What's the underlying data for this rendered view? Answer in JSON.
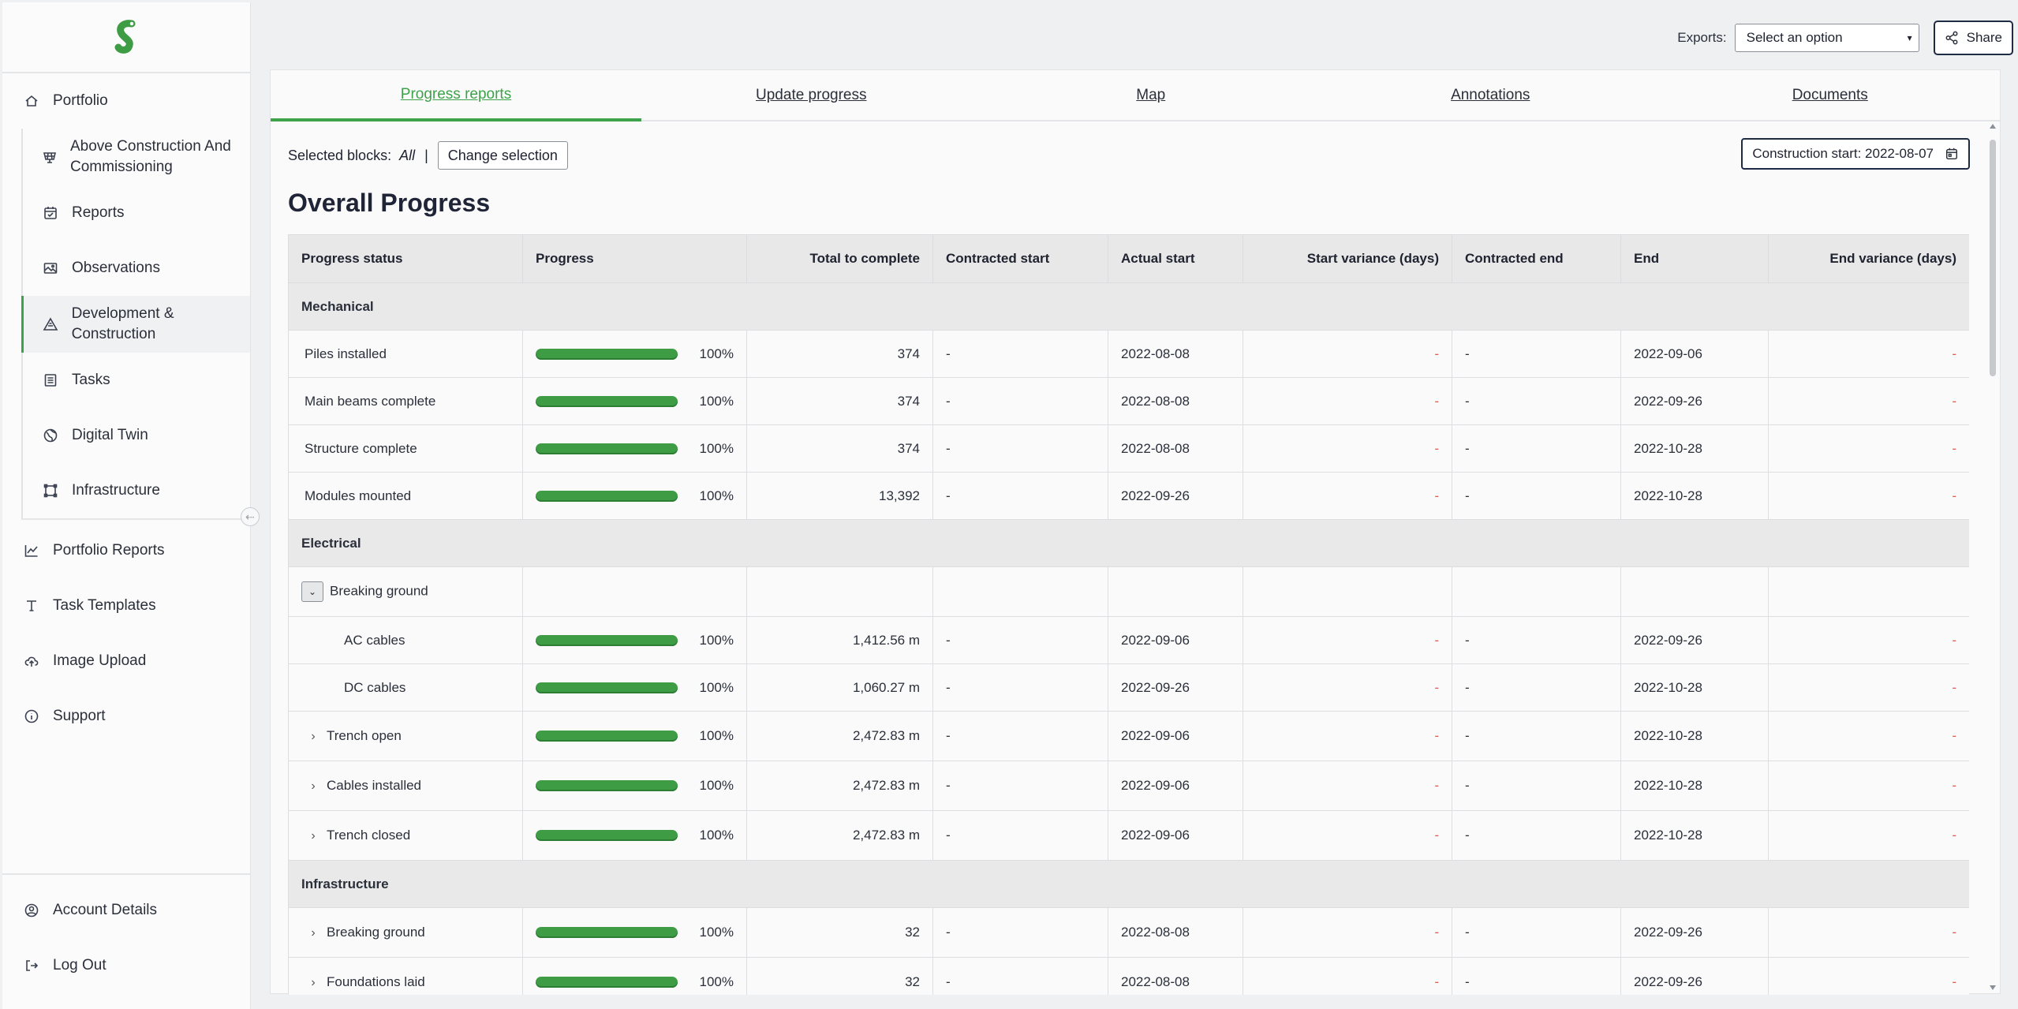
{
  "sidebar": {
    "top_items": [
      {
        "label": "Portfolio",
        "icon": "home-icon"
      }
    ],
    "sub_items": [
      {
        "label": "Above Construction And Commissioning",
        "icon": "solar-panel-icon"
      },
      {
        "label": "Reports",
        "icon": "calendar-check-icon"
      },
      {
        "label": "Observations",
        "icon": "image-icon"
      },
      {
        "label": "Development & Construction",
        "icon": "warning-cone-icon",
        "active": true
      },
      {
        "label": "Tasks",
        "icon": "list-icon"
      },
      {
        "label": "Digital Twin",
        "icon": "globe-icon"
      },
      {
        "label": "Infrastructure",
        "icon": "frame-icon"
      }
    ],
    "lower_items": [
      {
        "label": "Portfolio Reports",
        "icon": "chart-line-icon"
      },
      {
        "label": "Task Templates",
        "icon": "text-t-icon"
      },
      {
        "label": "Image Upload",
        "icon": "cloud-upload-icon"
      },
      {
        "label": "Support",
        "icon": "info-icon"
      }
    ],
    "bottom_items": [
      {
        "label": "Account Details",
        "icon": "user-circle-icon"
      },
      {
        "label": "Log Out",
        "icon": "logout-icon"
      }
    ]
  },
  "topbar": {
    "exports_label": "Exports:",
    "exports_value": "Select an option",
    "share_label": "Share"
  },
  "tabs": [
    "Progress reports",
    "Update progress",
    "Map",
    "Annotations",
    "Documents"
  ],
  "toolbar": {
    "selected_blocks_label": "Selected blocks:",
    "selected_blocks_value": "All",
    "separator": "|",
    "change_selection": "Change selection",
    "construction_start": "Construction start: 2022-08-07"
  },
  "page_title": "Overall Progress",
  "table": {
    "headers": [
      "Progress status",
      "Progress",
      "Total to complete",
      "Contracted start",
      "Actual start",
      "Start variance (days)",
      "Contracted end",
      "End",
      "End variance (days)"
    ],
    "rows": [
      {
        "type": "group",
        "label": "Mechanical"
      },
      {
        "type": "row",
        "label": "Piles installed",
        "progress": "100%",
        "total": "374",
        "cstart": "-",
        "astart": "2022-08-08",
        "svar": "-",
        "cend": "-",
        "end": "2022-09-06",
        "evar": "-"
      },
      {
        "type": "row",
        "label": "Main beams complete",
        "progress": "100%",
        "total": "374",
        "cstart": "-",
        "astart": "2022-08-08",
        "svar": "-",
        "cend": "-",
        "end": "2022-09-26",
        "evar": "-"
      },
      {
        "type": "row",
        "label": "Structure complete",
        "progress": "100%",
        "total": "374",
        "cstart": "-",
        "astart": "2022-08-08",
        "svar": "-",
        "cend": "-",
        "end": "2022-10-28",
        "evar": "-"
      },
      {
        "type": "row",
        "label": "Modules mounted",
        "progress": "100%",
        "total": "13,392",
        "cstart": "-",
        "astart": "2022-09-26",
        "svar": "-",
        "cend": "-",
        "end": "2022-10-28",
        "evar": "-"
      },
      {
        "type": "group",
        "label": "Electrical"
      },
      {
        "type": "parent-open",
        "label": "Breaking ground"
      },
      {
        "type": "child",
        "label": "AC cables",
        "progress": "100%",
        "total": "1,412.56 m",
        "cstart": "-",
        "astart": "2022-09-06",
        "svar": "-",
        "cend": "-",
        "end": "2022-09-26",
        "evar": "-"
      },
      {
        "type": "child",
        "label": "DC cables",
        "progress": "100%",
        "total": "1,060.27 m",
        "cstart": "-",
        "astart": "2022-09-26",
        "svar": "-",
        "cend": "-",
        "end": "2022-10-28",
        "evar": "-"
      },
      {
        "type": "collapsed",
        "label": "Trench open",
        "progress": "100%",
        "total": "2,472.83 m",
        "cstart": "-",
        "astart": "2022-09-06",
        "svar": "-",
        "cend": "-",
        "end": "2022-10-28",
        "evar": "-"
      },
      {
        "type": "collapsed",
        "label": "Cables installed",
        "progress": "100%",
        "total": "2,472.83 m",
        "cstart": "-",
        "astart": "2022-09-06",
        "svar": "-",
        "cend": "-",
        "end": "2022-10-28",
        "evar": "-"
      },
      {
        "type": "collapsed",
        "label": "Trench closed",
        "progress": "100%",
        "total": "2,472.83 m",
        "cstart": "-",
        "astart": "2022-09-06",
        "svar": "-",
        "cend": "-",
        "end": "2022-10-28",
        "evar": "-"
      },
      {
        "type": "group",
        "label": "Infrastructure"
      },
      {
        "type": "collapsed",
        "label": "Breaking ground",
        "progress": "100%",
        "total": "32",
        "cstart": "-",
        "astart": "2022-08-08",
        "svar": "-",
        "cend": "-",
        "end": "2022-09-26",
        "evar": "-"
      },
      {
        "type": "collapsed",
        "label": "Foundations laid",
        "progress": "100%",
        "total": "32",
        "cstart": "-",
        "astart": "2022-08-08",
        "svar": "-",
        "cend": "-",
        "end": "2022-09-26",
        "evar": "-"
      }
    ]
  },
  "colors": {
    "accent": "#3ea24a",
    "bar": "#3e9c45",
    "variance_dash": "#e05a5a"
  }
}
